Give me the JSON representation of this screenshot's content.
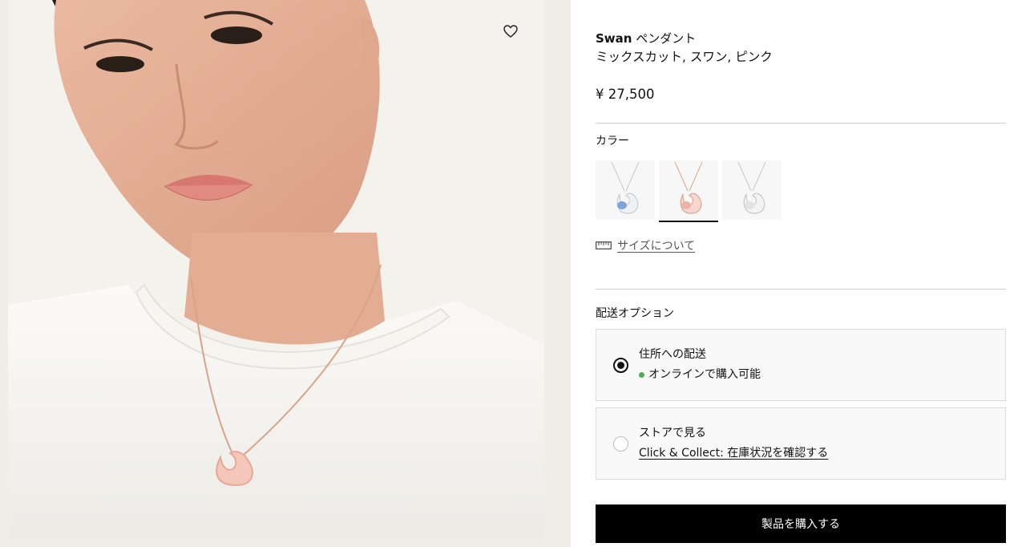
{
  "product": {
    "brand": "Swan",
    "name": "ペンダント",
    "subtitle": "ミックスカット, スワン, ピンク",
    "price": "¥ 27,500"
  },
  "color": {
    "label": "カラー",
    "options": [
      {
        "variant": "blue-rhodium",
        "selected": false
      },
      {
        "variant": "pink-rose-gold",
        "selected": true
      },
      {
        "variant": "white-rhodium",
        "selected": false
      }
    ]
  },
  "size_link": {
    "label": "サイズについて",
    "icon": "ruler-icon"
  },
  "delivery": {
    "label": "配送オプション",
    "options": [
      {
        "title": "住所への配送",
        "status": "オンラインで購入可能",
        "selected": true
      },
      {
        "title": "ストアで見る",
        "link": "Click & Collect: 在庫状況を確認する",
        "selected": false
      }
    ]
  },
  "buy_button": {
    "label": "製品を購入する"
  },
  "colors": {
    "accent": "#000000",
    "available": "#4caf50",
    "divider": "#cfcfcf"
  }
}
